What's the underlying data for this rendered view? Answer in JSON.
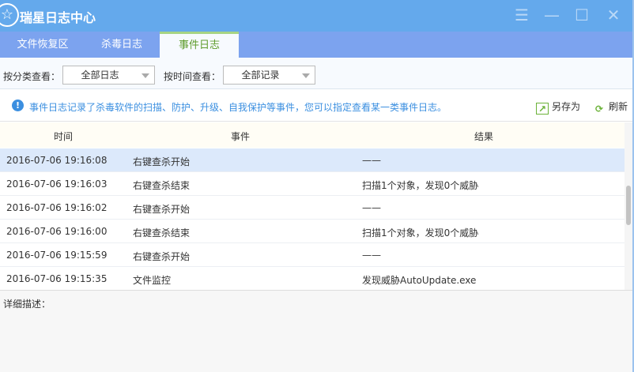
{
  "app": {
    "title": "瑞星日志中心"
  },
  "tabs": [
    {
      "label": "文件恢复区"
    },
    {
      "label": "杀毒日志"
    },
    {
      "label": "事件日志"
    }
  ],
  "filters": {
    "category_label": "按分类查看：",
    "category_value": "全部日志",
    "time_label": "按时间查看：",
    "time_value": "全部记录"
  },
  "info": {
    "text": "事件日志记录了杀毒软件的扫描、防护、升级、自我保护等事件，您可以指定查看某一类事件日志。",
    "save_as": "另存为",
    "refresh": "刷新"
  },
  "table": {
    "headers": [
      "时间",
      "事件",
      "结果"
    ],
    "rows": [
      {
        "time": "2016-07-06 19:16:08",
        "event": "右键查杀开始",
        "result": "——"
      },
      {
        "time": "2016-07-06 19:16:03",
        "event": "右键查杀结束",
        "result": "扫描1个对象，发现0个威胁"
      },
      {
        "time": "2016-07-06 19:16:02",
        "event": "右键查杀开始",
        "result": "——"
      },
      {
        "time": "2016-07-06 19:16:00",
        "event": "右键查杀结束",
        "result": "扫描1个对象，发现0个威胁"
      },
      {
        "time": "2016-07-06 19:15:59",
        "event": "右键查杀开始",
        "result": "——"
      },
      {
        "time": "2016-07-06 19:15:35",
        "event": "文件监控",
        "result": "发现威胁AutoUpdate.exe"
      }
    ]
  },
  "detail": {
    "label": "详细描述："
  }
}
